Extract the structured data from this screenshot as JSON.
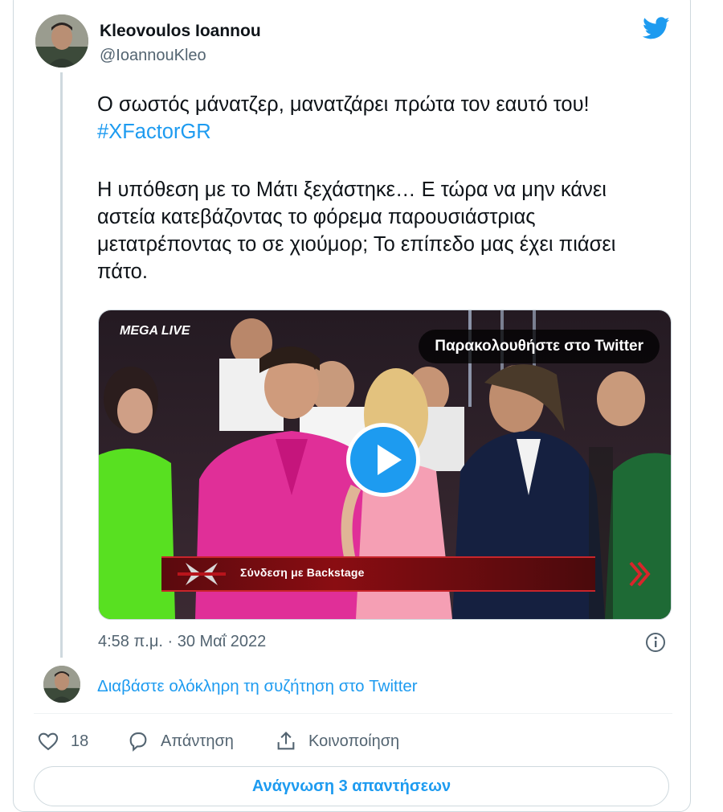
{
  "author": {
    "name": "Kleovoulos Ioannou",
    "handle": "@IoannouKleo"
  },
  "icons": {
    "brand": "twitter-bird-icon",
    "brand_color": "#1d9bf0",
    "like": "heart-icon",
    "reply": "speech-bubble-icon",
    "share": "share-upload-icon",
    "info": "info-icon",
    "play": "play-icon"
  },
  "tweet": {
    "line1_text": "Ο σωστός μάνατζερ, μανατζάρει πρώτα τον εαυτό του! ",
    "hashtag": "#XFactorGR",
    "paragraph2": "Η υπόθεση με το Μάτι ξεχάστηκε… Ε τώρα να μην κάνει αστεία κατεβάζοντας το φόρεμα παρουσιάστριας μετατρέποντας το σε χιούμορ; Το επίπεδο μας έχει πιάσει πάτο."
  },
  "media": {
    "watch_label": "Παρακολουθήστε στο Twitter",
    "banner_text": "Σύνδεση με Backstage",
    "channel_logo": "MEGA LIVE"
  },
  "meta": {
    "timestamp": "4:58 π.μ. · 30 Μαΐ 2022"
  },
  "thread": {
    "read_conversation": "Διαβάστε ολόκληρη τη συζήτηση στο Twitter"
  },
  "actions": {
    "like_count": "18",
    "reply_label": "Απάντηση",
    "share_label": "Κοινοποίηση"
  },
  "footer": {
    "read_replies": "Ανάγνωση 3 απαντήσεων"
  }
}
